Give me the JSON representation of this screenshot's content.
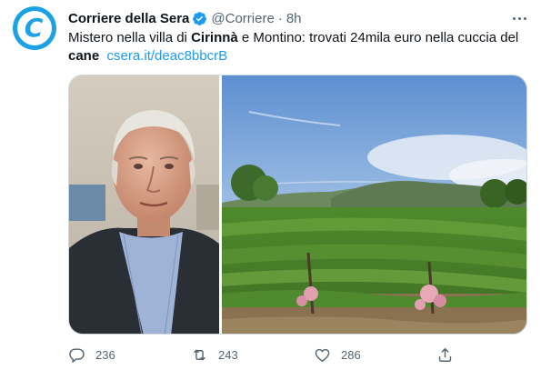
{
  "tweet": {
    "author_name": "Corriere della Sera",
    "handle": "@Corriere",
    "separator": "·",
    "time": "8h",
    "avatar_letter": "C",
    "text": {
      "part1": "Mistero nella villa di ",
      "bold1": "Cirinnà",
      "part2": " e Montino: trovati 24mila euro nella cuccia del ",
      "bold2": "cane",
      "link": "csera.it/deac8bbcrB"
    },
    "media": [
      {
        "icon": "portrait-photo"
      },
      {
        "icon": "vineyard-photo"
      }
    ],
    "actions": {
      "replies": "236",
      "retweets": "243",
      "likes": "286"
    }
  },
  "colors": {
    "brand": "#1da1e6",
    "link": "#1d9bf0",
    "secondary_text": "#536471",
    "primary_text": "#0f1419"
  }
}
